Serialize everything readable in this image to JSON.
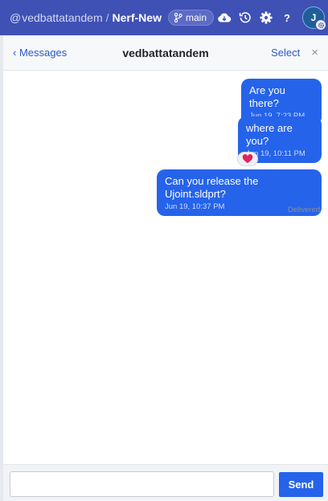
{
  "header": {
    "owner_prefix": "@",
    "owner": "vedbattatandem",
    "separator": "/",
    "repo": "Nerf-New",
    "branch": "main",
    "help_label": "?",
    "avatar_initial": "J",
    "icons": [
      "branch-icon",
      "cloud-download-icon",
      "history-icon",
      "gear-icon",
      "help-icon",
      "avatar-settings-icon"
    ],
    "bar_color": "#3f51b5"
  },
  "messages_header": {
    "back_label": "‹ Messages",
    "contact": "vedbattatandem",
    "select_label": "Select",
    "close_label": "×"
  },
  "thread": {
    "messages": [
      {
        "text": "Are you there?",
        "time": "Jun 19, 7:23 PM"
      },
      {
        "text": "where are you?",
        "time": "Jun 19, 10:11 PM",
        "reaction": "heart"
      },
      {
        "text": "Can you release the Ujoint.sldprt?",
        "time": "Jun 19, 10:37 PM"
      }
    ],
    "status": "Delivered",
    "bubble_color": "#2563eb",
    "reaction_color": "#e0245e"
  },
  "composer": {
    "input_value": "",
    "input_placeholder": "",
    "send_label": "Send"
  }
}
